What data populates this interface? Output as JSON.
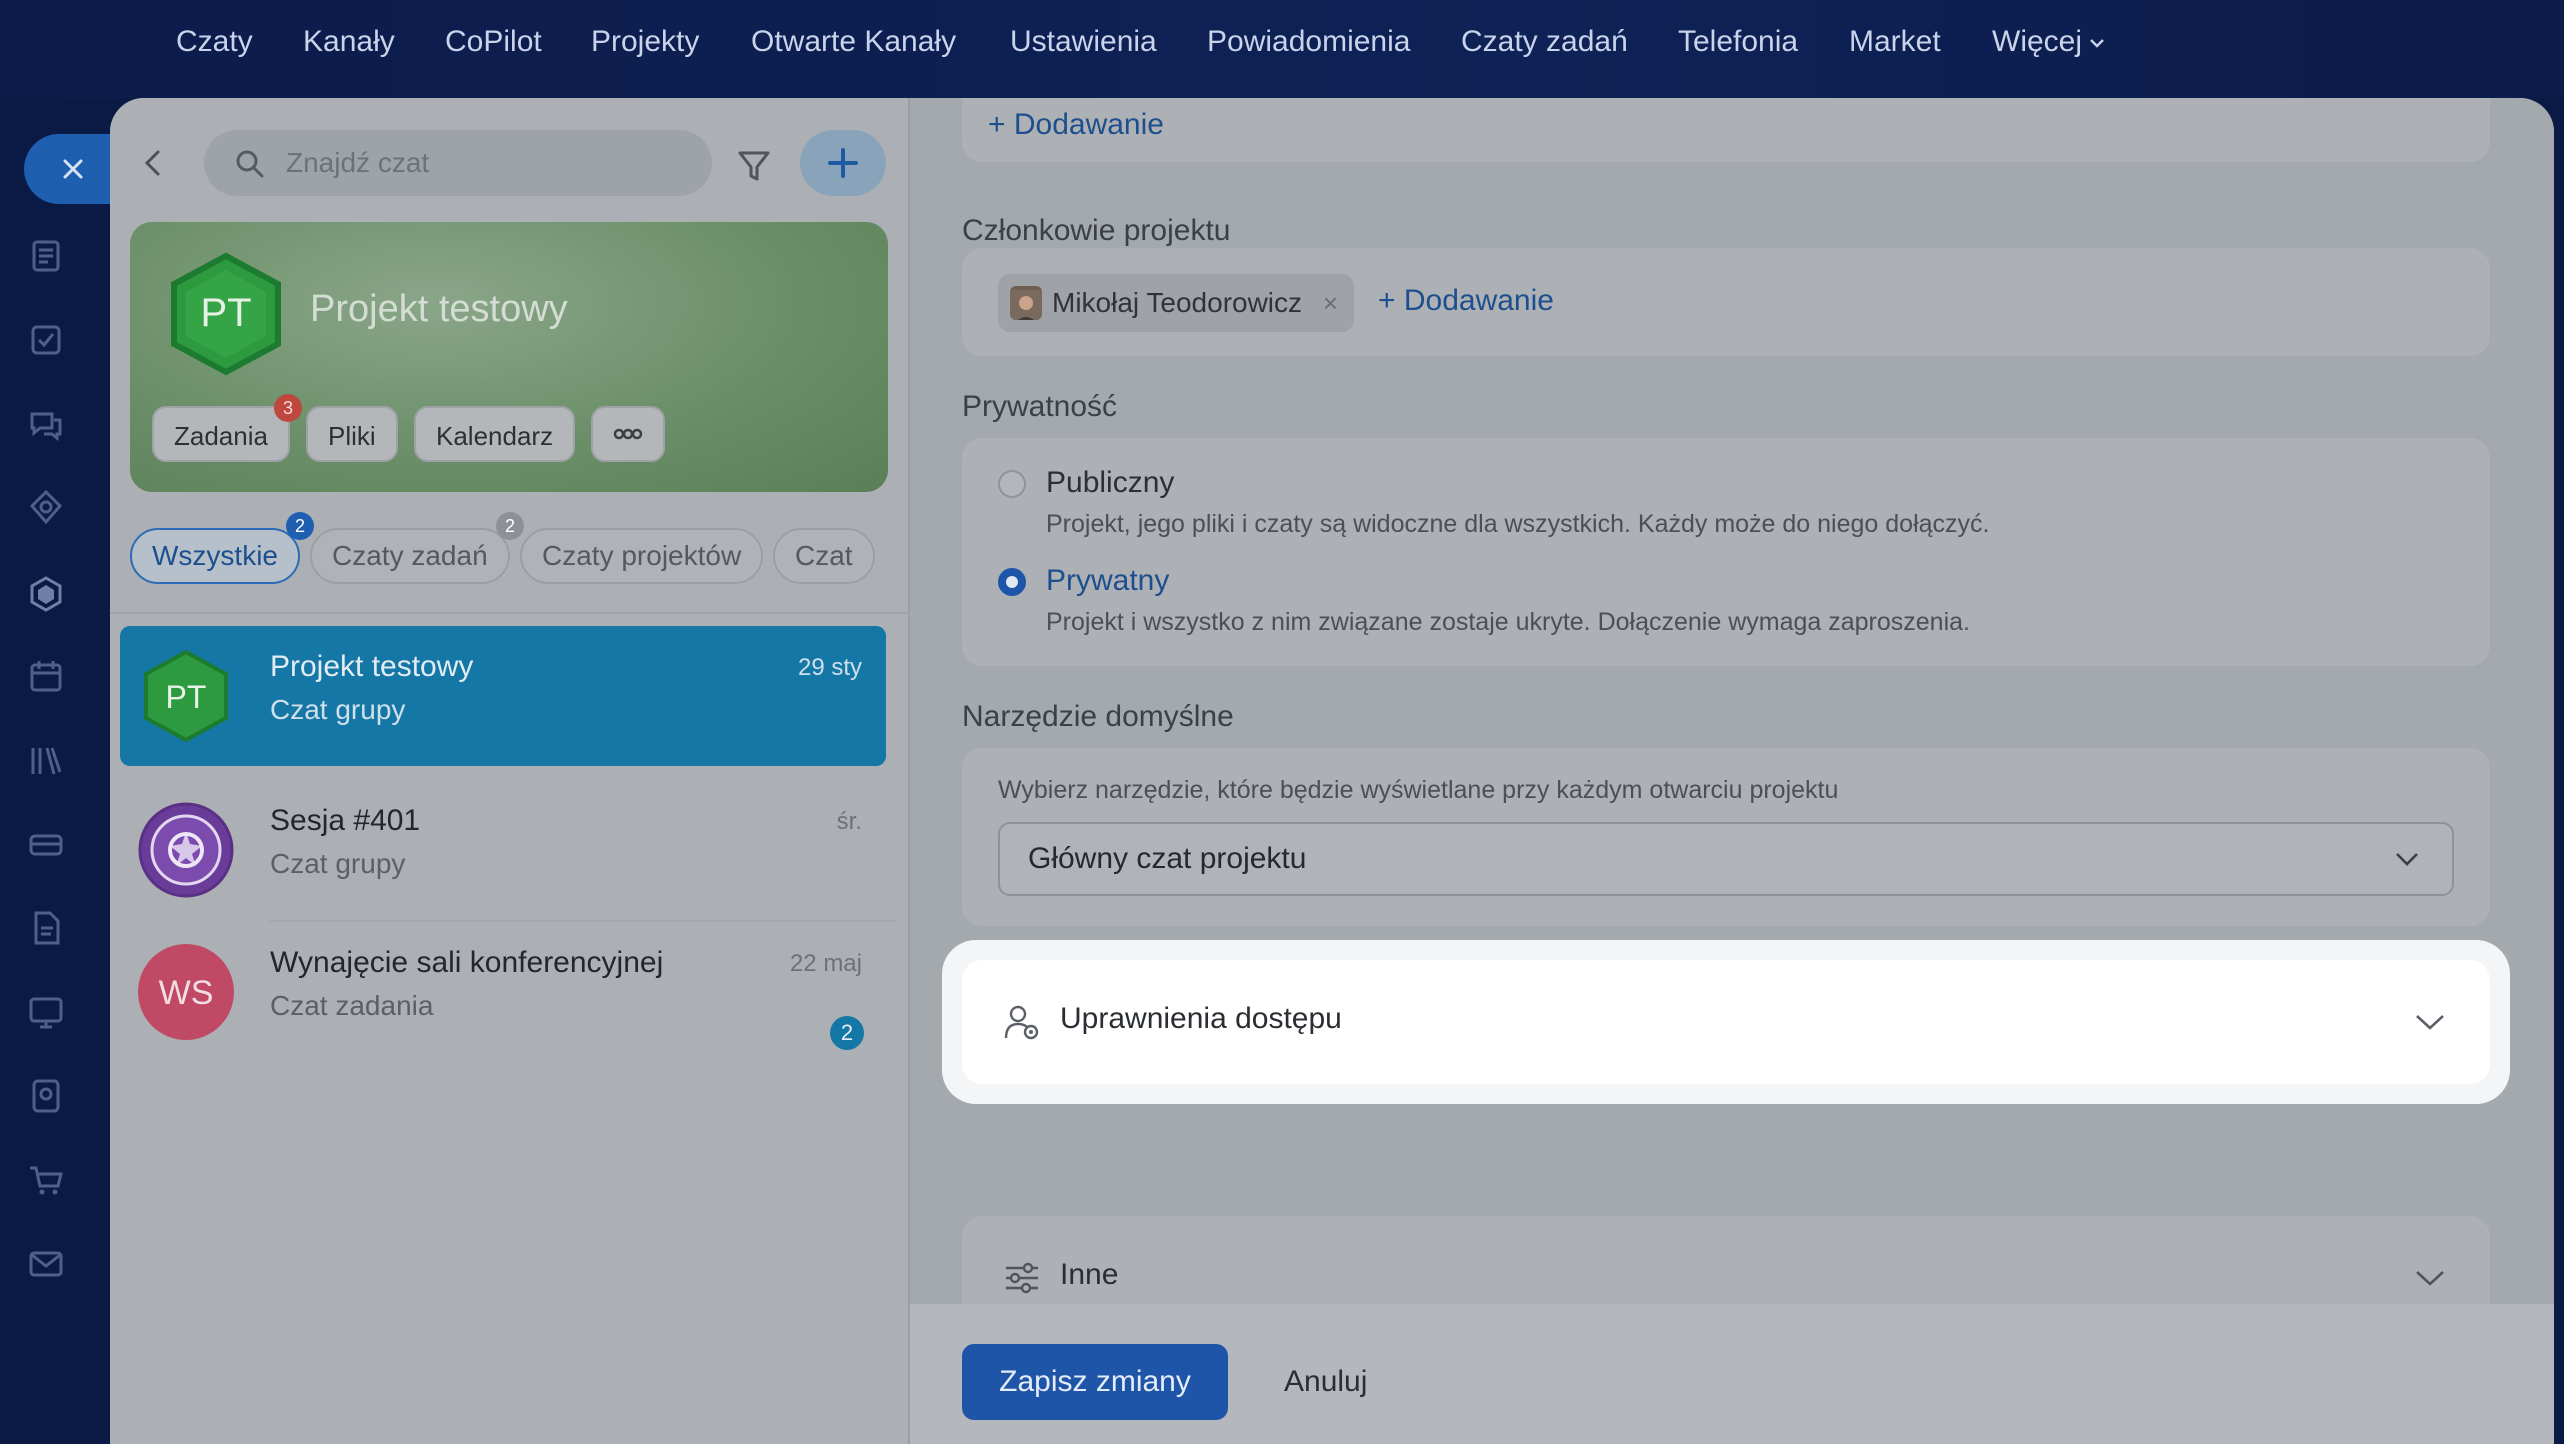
{
  "topnav": {
    "items": [
      "Czaty",
      "Kanały",
      "CoPilot",
      "Projekty",
      "Otwarte Kanały",
      "Ustawienia",
      "Powiadomienia",
      "Czaty zadań",
      "Telefonia",
      "Market",
      "Więcej"
    ]
  },
  "chat_panel": {
    "search_placeholder": "Znajdź czat",
    "project": {
      "initials": "PT",
      "title": "Projekt testowy",
      "chips": [
        "Zadania",
        "Pliki",
        "Kalendarz"
      ],
      "tasks_badge": "3"
    },
    "filters": [
      {
        "label": "Wszystkie",
        "badge": "2",
        "active": true
      },
      {
        "label": "Czaty zadań",
        "badge": "2",
        "active": false
      },
      {
        "label": "Czaty projektów",
        "badge": "",
        "active": false
      },
      {
        "label": "Czat",
        "badge": "",
        "active": false
      }
    ],
    "chats": [
      {
        "initials": "PT",
        "name": "Projekt testowy",
        "subtitle": "Czat grupy",
        "date": "29 sty",
        "unread": ""
      },
      {
        "initials": "",
        "name": "Sesja #401",
        "subtitle": "Czat grupy",
        "date": "śr.",
        "unread": ""
      },
      {
        "initials": "WS",
        "name": "Wynajęcie sali konferencyjnej",
        "subtitle": "Czat zadania",
        "date": "22 maj",
        "unread": "2"
      }
    ]
  },
  "settings": {
    "top_add_link": "+ Dodawanie",
    "members": {
      "label": "Członkowie projektu",
      "member_name": "Mikołaj Teodorowicz",
      "add_link": "+ Dodawanie"
    },
    "privacy": {
      "label": "Prywatność",
      "options": [
        {
          "title": "Publiczny",
          "desc": "Projekt, jego pliki i czaty są widoczne dla wszystkich. Każdy może do niego dołączyć.",
          "selected": false
        },
        {
          "title": "Prywatny",
          "desc": "Projekt i wszystko z nim związane zostaje ukryte. Dołączenie wymaga zaproszenia.",
          "selected": true
        }
      ]
    },
    "default_tool": {
      "label": "Narzędzie domyślne",
      "hint": "Wybierz narzędzie, które będzie wyświetlane przy każdym otwarciu projektu",
      "value": "Główny czat projektu"
    },
    "access": {
      "title": "Uprawnienia dostępu"
    },
    "other": {
      "title": "Inne"
    },
    "save_label": "Zapisz zmiany",
    "cancel_label": "Anuluj"
  },
  "colors": {
    "accent": "#1f55a9",
    "nav_bg": "#0c1b4a",
    "active_chat": "#1477a6"
  }
}
